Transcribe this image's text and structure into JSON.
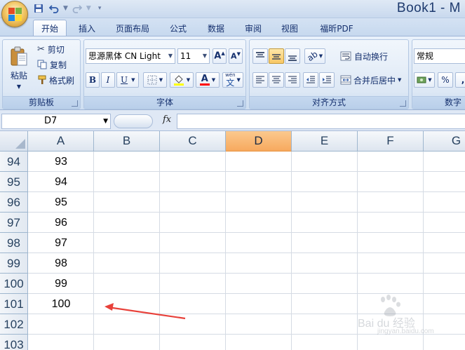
{
  "window": {
    "title": "Book1 - M"
  },
  "tabs": [
    {
      "label": "开始",
      "active": true
    },
    {
      "label": "插入"
    },
    {
      "label": "页面布局"
    },
    {
      "label": "公式"
    },
    {
      "label": "数据"
    },
    {
      "label": "审阅"
    },
    {
      "label": "视图"
    },
    {
      "label": "福昕PDF"
    }
  ],
  "clipboard": {
    "paste_label": "粘贴",
    "cut_label": "剪切",
    "copy_label": "复制",
    "format_painter_label": "格式刷",
    "group_label": "剪贴板"
  },
  "font": {
    "family": "思源黑体 CN Light",
    "size": "11",
    "bold": "B",
    "italic": "I",
    "underline": "U",
    "font_color": "A",
    "phonetic": "wén",
    "phonetic_char": "文",
    "group_label": "字体"
  },
  "alignment": {
    "wrap_text_label": "自动换行",
    "merge_label": "合并后居中",
    "group_label": "对齐方式"
  },
  "number": {
    "format": "常规",
    "percent": "%",
    "comma": ",",
    "group_label": "数字"
  },
  "formula_bar": {
    "name_box": "D7",
    "fx": "fx"
  },
  "columns": [
    "A",
    "B",
    "C",
    "D",
    "E",
    "F",
    "G"
  ],
  "selected_column": "D",
  "rows": [
    {
      "num": "94",
      "a": "93"
    },
    {
      "num": "95",
      "a": "94"
    },
    {
      "num": "96",
      "a": "95"
    },
    {
      "num": "97",
      "a": "96"
    },
    {
      "num": "98",
      "a": "97"
    },
    {
      "num": "99",
      "a": "98"
    },
    {
      "num": "100",
      "a": "99"
    },
    {
      "num": "101",
      "a": "100"
    },
    {
      "num": "102",
      "a": ""
    },
    {
      "num": "103",
      "a": ""
    }
  ],
  "annotation": {
    "color": "#e8413a"
  },
  "watermark": {
    "text": "Bai du 经验",
    "sub": "jingyan.baidu.com"
  },
  "colors": {
    "accent": "#f7a95e",
    "ribbon": "#dbe7f5",
    "arrow": "#e8413a"
  }
}
